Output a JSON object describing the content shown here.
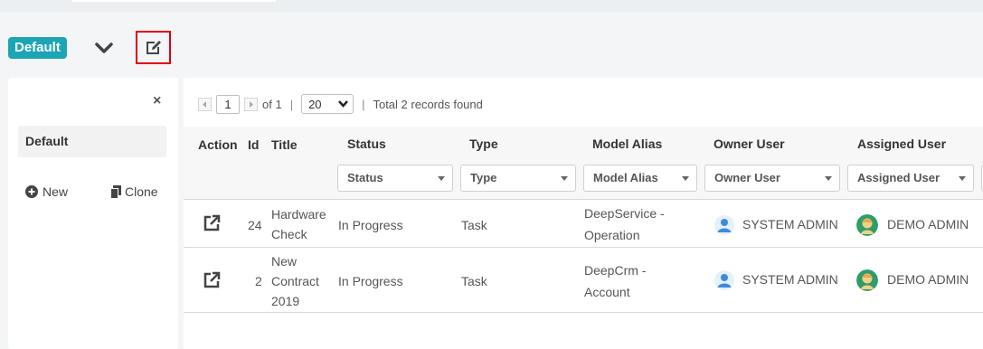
{
  "view": {
    "name": "Default"
  },
  "sidebar": {
    "close_glyph": "×",
    "items": [
      {
        "label": "Default"
      }
    ],
    "new_label": "New",
    "clone_label": "Clone"
  },
  "pager": {
    "page": "1",
    "of_text": "of 1",
    "sep1": "|",
    "page_size": "20",
    "sep2": "|",
    "summary": "Total 2 records found"
  },
  "table": {
    "headers": {
      "action": "Action",
      "id": "Id",
      "title": "Title",
      "status": "Status",
      "type": "Type",
      "model_alias": "Model Alias",
      "owner_user": "Owner User",
      "assigned_user": "Assigned User"
    },
    "filters": {
      "status": "Status",
      "type": "Type",
      "model_alias": "Model Alias",
      "owner_user": "Owner User",
      "assigned_user": "Assigned User"
    },
    "rows": [
      {
        "id": "24",
        "title": [
          "Hardware",
          "Check"
        ],
        "status": "In Progress",
        "type": "Task",
        "model_alias": [
          "DeepService -",
          "Operation"
        ],
        "owner": "SYSTEM ADMIN",
        "assigned": "DEMO ADMIN"
      },
      {
        "id": "2",
        "title": [
          "New",
          "Contract",
          "2019"
        ],
        "status": "In Progress",
        "type": "Task",
        "model_alias": [
          "DeepCrm -",
          "Account"
        ],
        "owner": "SYSTEM ADMIN",
        "assigned": "DEMO ADMIN"
      }
    ]
  },
  "colors": {
    "badge": "#1ba5b5",
    "highlight": "#e0000f",
    "avatar_system": "#3d8bdb",
    "avatar_demo": "#2e9d6a"
  }
}
